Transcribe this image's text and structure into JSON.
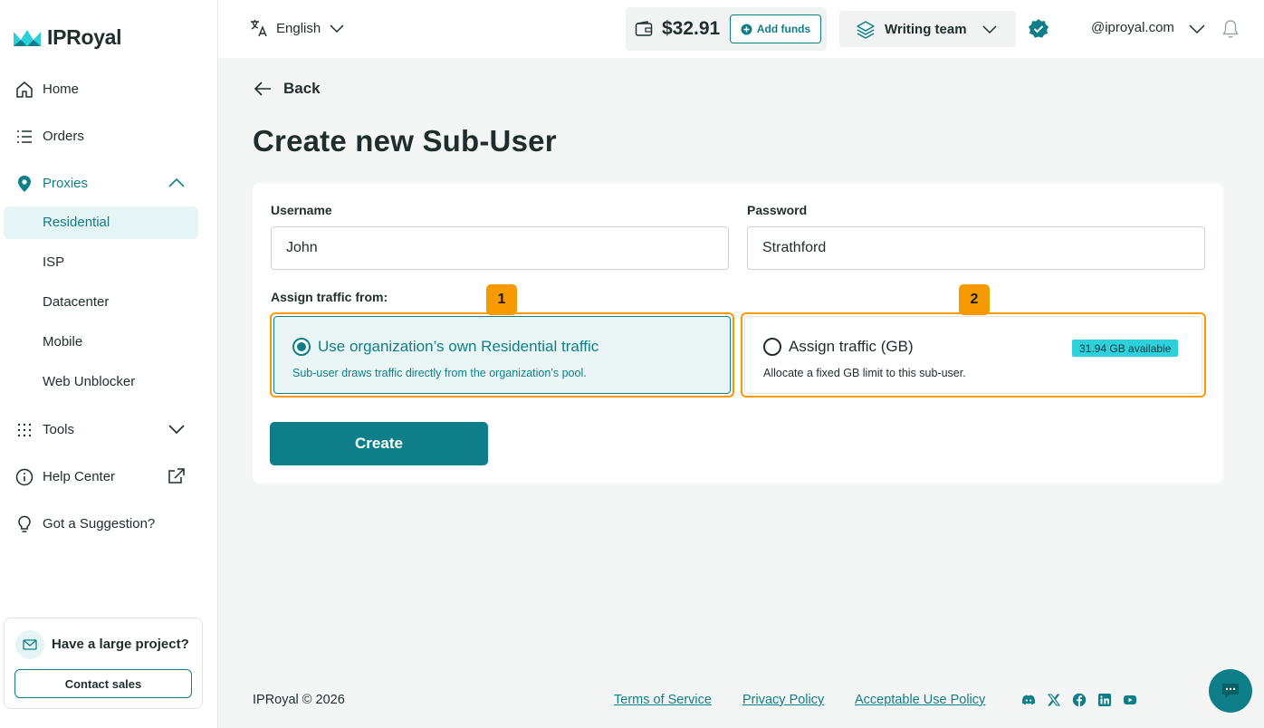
{
  "app": {
    "brand": "IPRoyal",
    "accent": "#0e7f88",
    "highlight": "#f59b00"
  },
  "sidebar": {
    "items": [
      {
        "label": "Home",
        "icon": "home-icon"
      },
      {
        "label": "Orders",
        "icon": "list-icon"
      },
      {
        "label": "Proxies",
        "icon": "location-pin-icon",
        "expanded": true
      },
      {
        "label": "Tools",
        "icon": "grid-dots-icon"
      },
      {
        "label": "Help Center",
        "icon": "info-icon"
      },
      {
        "label": "Got a Suggestion?",
        "icon": "lightbulb-icon"
      }
    ],
    "proxies_sub": [
      "Residential",
      "ISP",
      "Datacenter",
      "Mobile",
      "Web Unblocker"
    ],
    "promo": {
      "title": "Have a large project?",
      "button": "Contact sales"
    }
  },
  "topbar": {
    "language": "English",
    "balance": "$32.91",
    "add_funds": "Add funds",
    "team": "Writing team",
    "account": "@iproyal.com"
  },
  "main": {
    "back": "Back",
    "title": "Create new Sub-User",
    "username_label": "Username",
    "username_value": "John",
    "password_label": "Password",
    "password_value": "Strathford",
    "assign_label": "Assign traffic from:",
    "option1": {
      "badge": "1",
      "title": "Use organization’s own Residential traffic",
      "desc": "Sub-user draws traffic directly from the organization’s pool.",
      "selected": true
    },
    "option2": {
      "badge": "2",
      "title": "Assign traffic (GB)",
      "desc": "Allocate a fixed GB limit to this sub-user.",
      "available": "31.94 GB available",
      "selected": false
    },
    "create": "Create"
  },
  "footer": {
    "copyright": "IPRoyal © 2026",
    "links": [
      "Terms of Service",
      "Privacy Policy",
      "Acceptable Use Policy"
    ]
  }
}
